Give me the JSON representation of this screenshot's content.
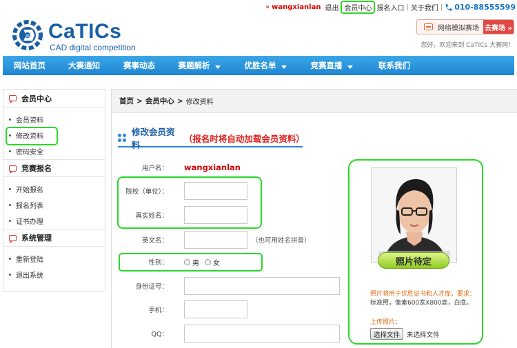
{
  "topbar": {
    "raquo": "»",
    "username": "wangxianlan",
    "logout": "退出",
    "member_center": "会员中心",
    "signup_entry": "报名入口",
    "about": "关于我们",
    "phone": "010-88555599"
  },
  "header": {
    "logo_name": "CaTICs",
    "logo_sub": "CAD digital competition",
    "sim_label": "网络模拟赛场",
    "sim_go": "去赛场 »",
    "welcome": "您好，欢迎来到 CaTICs 大赛网！"
  },
  "nav": {
    "items": [
      {
        "label": "网站首页",
        "caret": false
      },
      {
        "label": "大赛通知",
        "caret": false
      },
      {
        "label": "赛事动态",
        "caret": false
      },
      {
        "label": "赛题解析",
        "caret": true
      },
      {
        "label": "优胜名单",
        "caret": true
      },
      {
        "label": "竞赛直播",
        "caret": true
      },
      {
        "label": "联系我们",
        "caret": false
      }
    ]
  },
  "sidebar": {
    "groups": [
      {
        "title": "会员中心",
        "items": [
          "会员资料",
          "修改资料",
          "密码安全"
        ]
      },
      {
        "title": "竞赛报名",
        "items": [
          "开始报名",
          "报名列表",
          "证书办理"
        ]
      },
      {
        "title": "系统管理",
        "items": [
          "重新登陆",
          "退出系统"
        ]
      }
    ]
  },
  "breadcrumb": {
    "home": "首页",
    "member": "会员中心",
    "current": "修改资料",
    "sep": ">"
  },
  "section": {
    "title": "修改会员资料",
    "subtitle": "（报名时将自动加载会员资料）"
  },
  "form": {
    "username_label": "用户名：",
    "username_value": "wangxianlan",
    "school_label": "院校（单位）：",
    "realname_label": "真实姓名：",
    "english_label": "英文名：",
    "english_hint": "（也可用姓名拼音）",
    "gender_label": "性别：",
    "gender_male": "男",
    "gender_female": "女",
    "idcard_label": "身份证号：",
    "mobile_label": "手机：",
    "qq_label": "QQ："
  },
  "photo": {
    "placeholder_text": "照片待定",
    "note_orange": "照片将用于优胜证书和人才库，要求：",
    "note_gray": "标准照，像素600宽X800高，白底。",
    "upload_label": "上传照片：",
    "file_button": "选择文件",
    "file_state": "未选择文件"
  },
  "colors": {
    "nav_blue": "#1f86d2",
    "brand_blue": "#1a5fa6",
    "accent_red": "#e02020",
    "highlight_green": "#2ad82a"
  }
}
